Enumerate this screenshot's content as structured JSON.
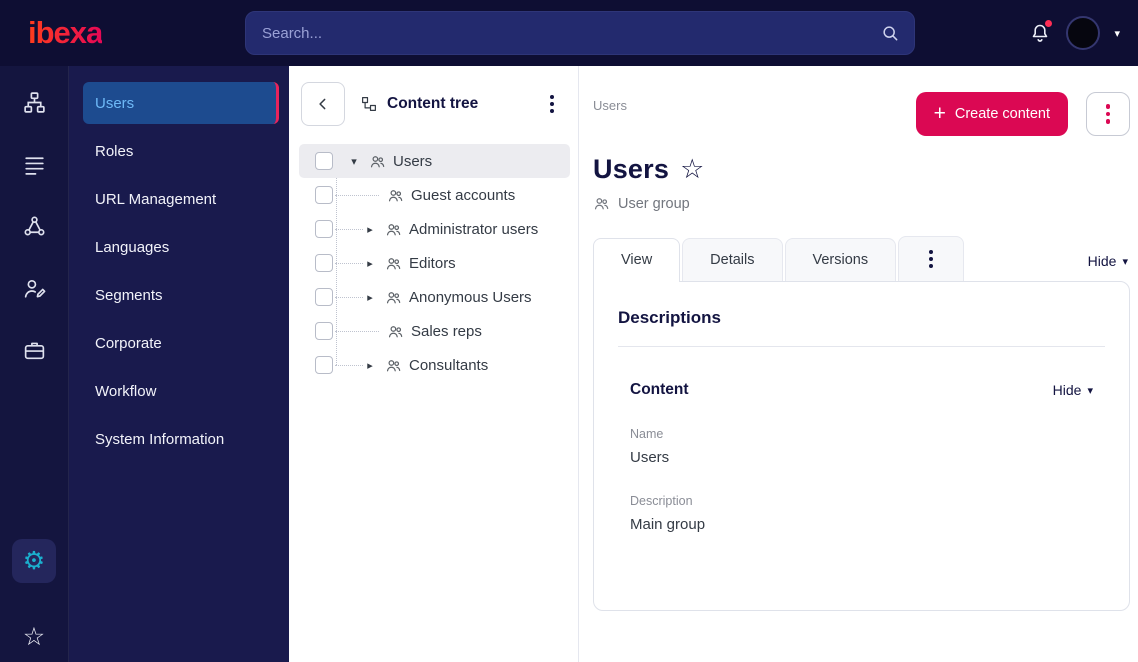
{
  "topbar": {
    "logo_text": "ibexa",
    "search_placeholder": "Search..."
  },
  "glyphs": {
    "plus": "+",
    "caret_down": "▾",
    "caret_right": "▸",
    "star_outline": "☆",
    "gear": "⚙"
  },
  "icons": {
    "topbar": [
      "search-icon",
      "notifications-bell-icon",
      "avatar",
      "caret-down-icon"
    ],
    "rail": [
      "content-structure-icon",
      "content-list-icon",
      "relations-icon",
      "user-edit-icon",
      "toolbox-icon"
    ],
    "rail_bottom": [
      "settings-gear-icon",
      "bookmarks-star-icon"
    ],
    "tree_header": [
      "back-chevron-icon",
      "content-tree-icon",
      "kebab-menu-icon"
    ],
    "tree_item": "user-group-icon",
    "title_action": "favorite-star-icon"
  },
  "colors": {
    "accent": "#db0853",
    "topbar_bg": "#0e0e33",
    "rail_bg": "#14153f",
    "sidebar_bg": "#191a4d",
    "active_item_bg": "#1d4b8f",
    "active_item_text": "#6eb9f7",
    "settings_icon": "#1bb0ce",
    "navy_text": "#131441"
  },
  "sidebar": {
    "items": [
      {
        "label": "Users",
        "active": true
      },
      {
        "label": "Roles"
      },
      {
        "label": "URL Management"
      },
      {
        "label": "Languages"
      },
      {
        "label": "Segments"
      },
      {
        "label": "Corporate"
      },
      {
        "label": "Workflow"
      },
      {
        "label": "System Information"
      }
    ]
  },
  "content_tree": {
    "title": "Content tree",
    "items": [
      {
        "label": "Users",
        "state": "expanded",
        "selected": true
      },
      {
        "label": "Guest accounts",
        "state": "leaf"
      },
      {
        "label": "Administrator users",
        "state": "collapsed"
      },
      {
        "label": "Editors",
        "state": "collapsed"
      },
      {
        "label": "Anonymous Users",
        "state": "collapsed"
      },
      {
        "label": "Sales reps",
        "state": "leaf"
      },
      {
        "label": "Consultants",
        "state": "collapsed"
      }
    ]
  },
  "main": {
    "breadcrumb": "Users",
    "create_button_label": "Create content",
    "title": "Users",
    "content_type": "User group",
    "tabs": [
      {
        "label": "View",
        "active": true
      },
      {
        "label": "Details"
      },
      {
        "label": "Versions"
      }
    ],
    "hide_label": "Hide",
    "card": {
      "heading": "Descriptions",
      "section": {
        "heading": "Content",
        "hide_label": "Hide",
        "fields": [
          {
            "label": "Name",
            "value": "Users"
          },
          {
            "label": "Description",
            "value": "Main group"
          }
        ]
      }
    }
  }
}
